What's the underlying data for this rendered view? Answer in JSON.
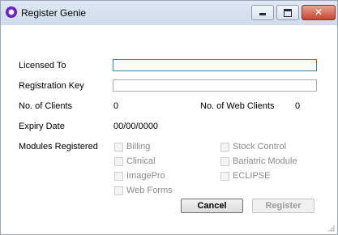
{
  "window": {
    "title": "Register Genie",
    "icon": "genie-app-icon",
    "controls": {
      "minimize": "minimize-icon",
      "maximize": "maximize-icon",
      "close": "✕"
    }
  },
  "form": {
    "licensed_to": {
      "label": "Licensed To",
      "value": ""
    },
    "registration_key": {
      "label": "Registration Key",
      "value": ""
    },
    "no_of_clients": {
      "label": "No. of Clients",
      "value": "0"
    },
    "no_of_web_clients": {
      "label": "No. of Web Clients",
      "value": "0"
    },
    "expiry_date": {
      "label": "Expiry Date",
      "value": "00/00/0000"
    },
    "modules_label": "Modules Registered"
  },
  "modules": {
    "billing": {
      "label": "Billing",
      "checked": false
    },
    "clinical": {
      "label": "Clinical",
      "checked": false
    },
    "imagepro": {
      "label": "ImagePro",
      "checked": false
    },
    "web_forms": {
      "label": "Web Forms",
      "checked": false
    },
    "stock_control": {
      "label": "Stock Control",
      "checked": false
    },
    "bariatric_module": {
      "label": "Bariatric Module",
      "checked": false
    },
    "eclipse": {
      "label": "ECLIPSE",
      "checked": false
    }
  },
  "buttons": {
    "cancel": "Cancel",
    "register": "Register"
  }
}
